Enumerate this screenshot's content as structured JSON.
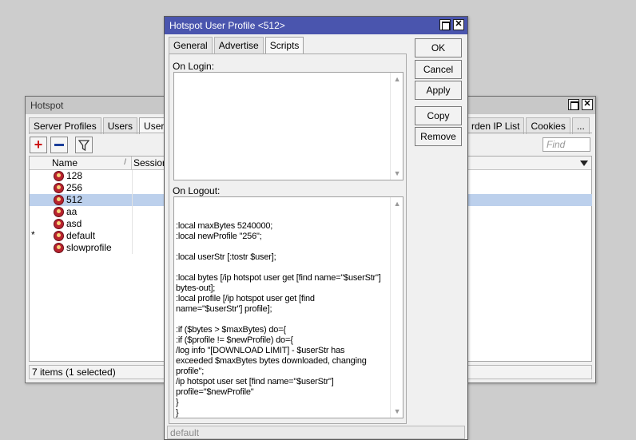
{
  "hotspot_window": {
    "title": "Hotspot",
    "tabs_left": [
      "Server Profiles",
      "Users",
      "User Profi"
    ],
    "tabs_right": [
      "rden IP List",
      "Cookies",
      "..."
    ],
    "toolbar": {
      "add_label": "+",
      "remove_label": "−"
    },
    "find_placeholder": "Find",
    "columns": {
      "name": "Name",
      "sort_glyph": "/",
      "session": "Session"
    },
    "rows": [
      {
        "name": "128",
        "marker": ""
      },
      {
        "name": "256",
        "marker": ""
      },
      {
        "name": "512",
        "marker": ""
      },
      {
        "name": "aa",
        "marker": ""
      },
      {
        "name": "asd",
        "marker": ""
      },
      {
        "name": "default",
        "marker": "*"
      },
      {
        "name": "slowprofile",
        "marker": ""
      }
    ],
    "selected_row": "512",
    "status": "7 items (1 selected)"
  },
  "profile_dialog": {
    "title": "Hotspot User Profile <512>",
    "tabs": [
      "General",
      "Advertise",
      "Scripts"
    ],
    "active_tab": "Scripts",
    "on_login_label": "On Login:",
    "on_login_value": "",
    "on_logout_label": "On Logout:",
    "on_logout_value": "\n:local maxBytes 5240000;\n:local newProfile \"256\";\n\n:local userStr [:tostr $user];\n\n:local bytes [/ip hotspot user get [find name=\"$userStr\"]\nbytes-out];\n:local profile [/ip hotspot user get [find\nname=\"$userStr\"] profile];\n\n:if ($bytes > $maxBytes) do={\n:if ($profile != $newProfile) do={\n/log info \"[DOWNLOAD LIMIT] - $userStr has\nexceeded $maxBytes bytes downloaded, changing\nprofile\";\n/ip hotspot user set [find name=\"$userStr\"]\nprofile=\"$newProfile\"\n}\n}",
    "buttons": {
      "ok": "OK",
      "cancel": "Cancel",
      "apply": "Apply",
      "copy": "Copy",
      "remove": "Remove"
    },
    "status": "default"
  }
}
